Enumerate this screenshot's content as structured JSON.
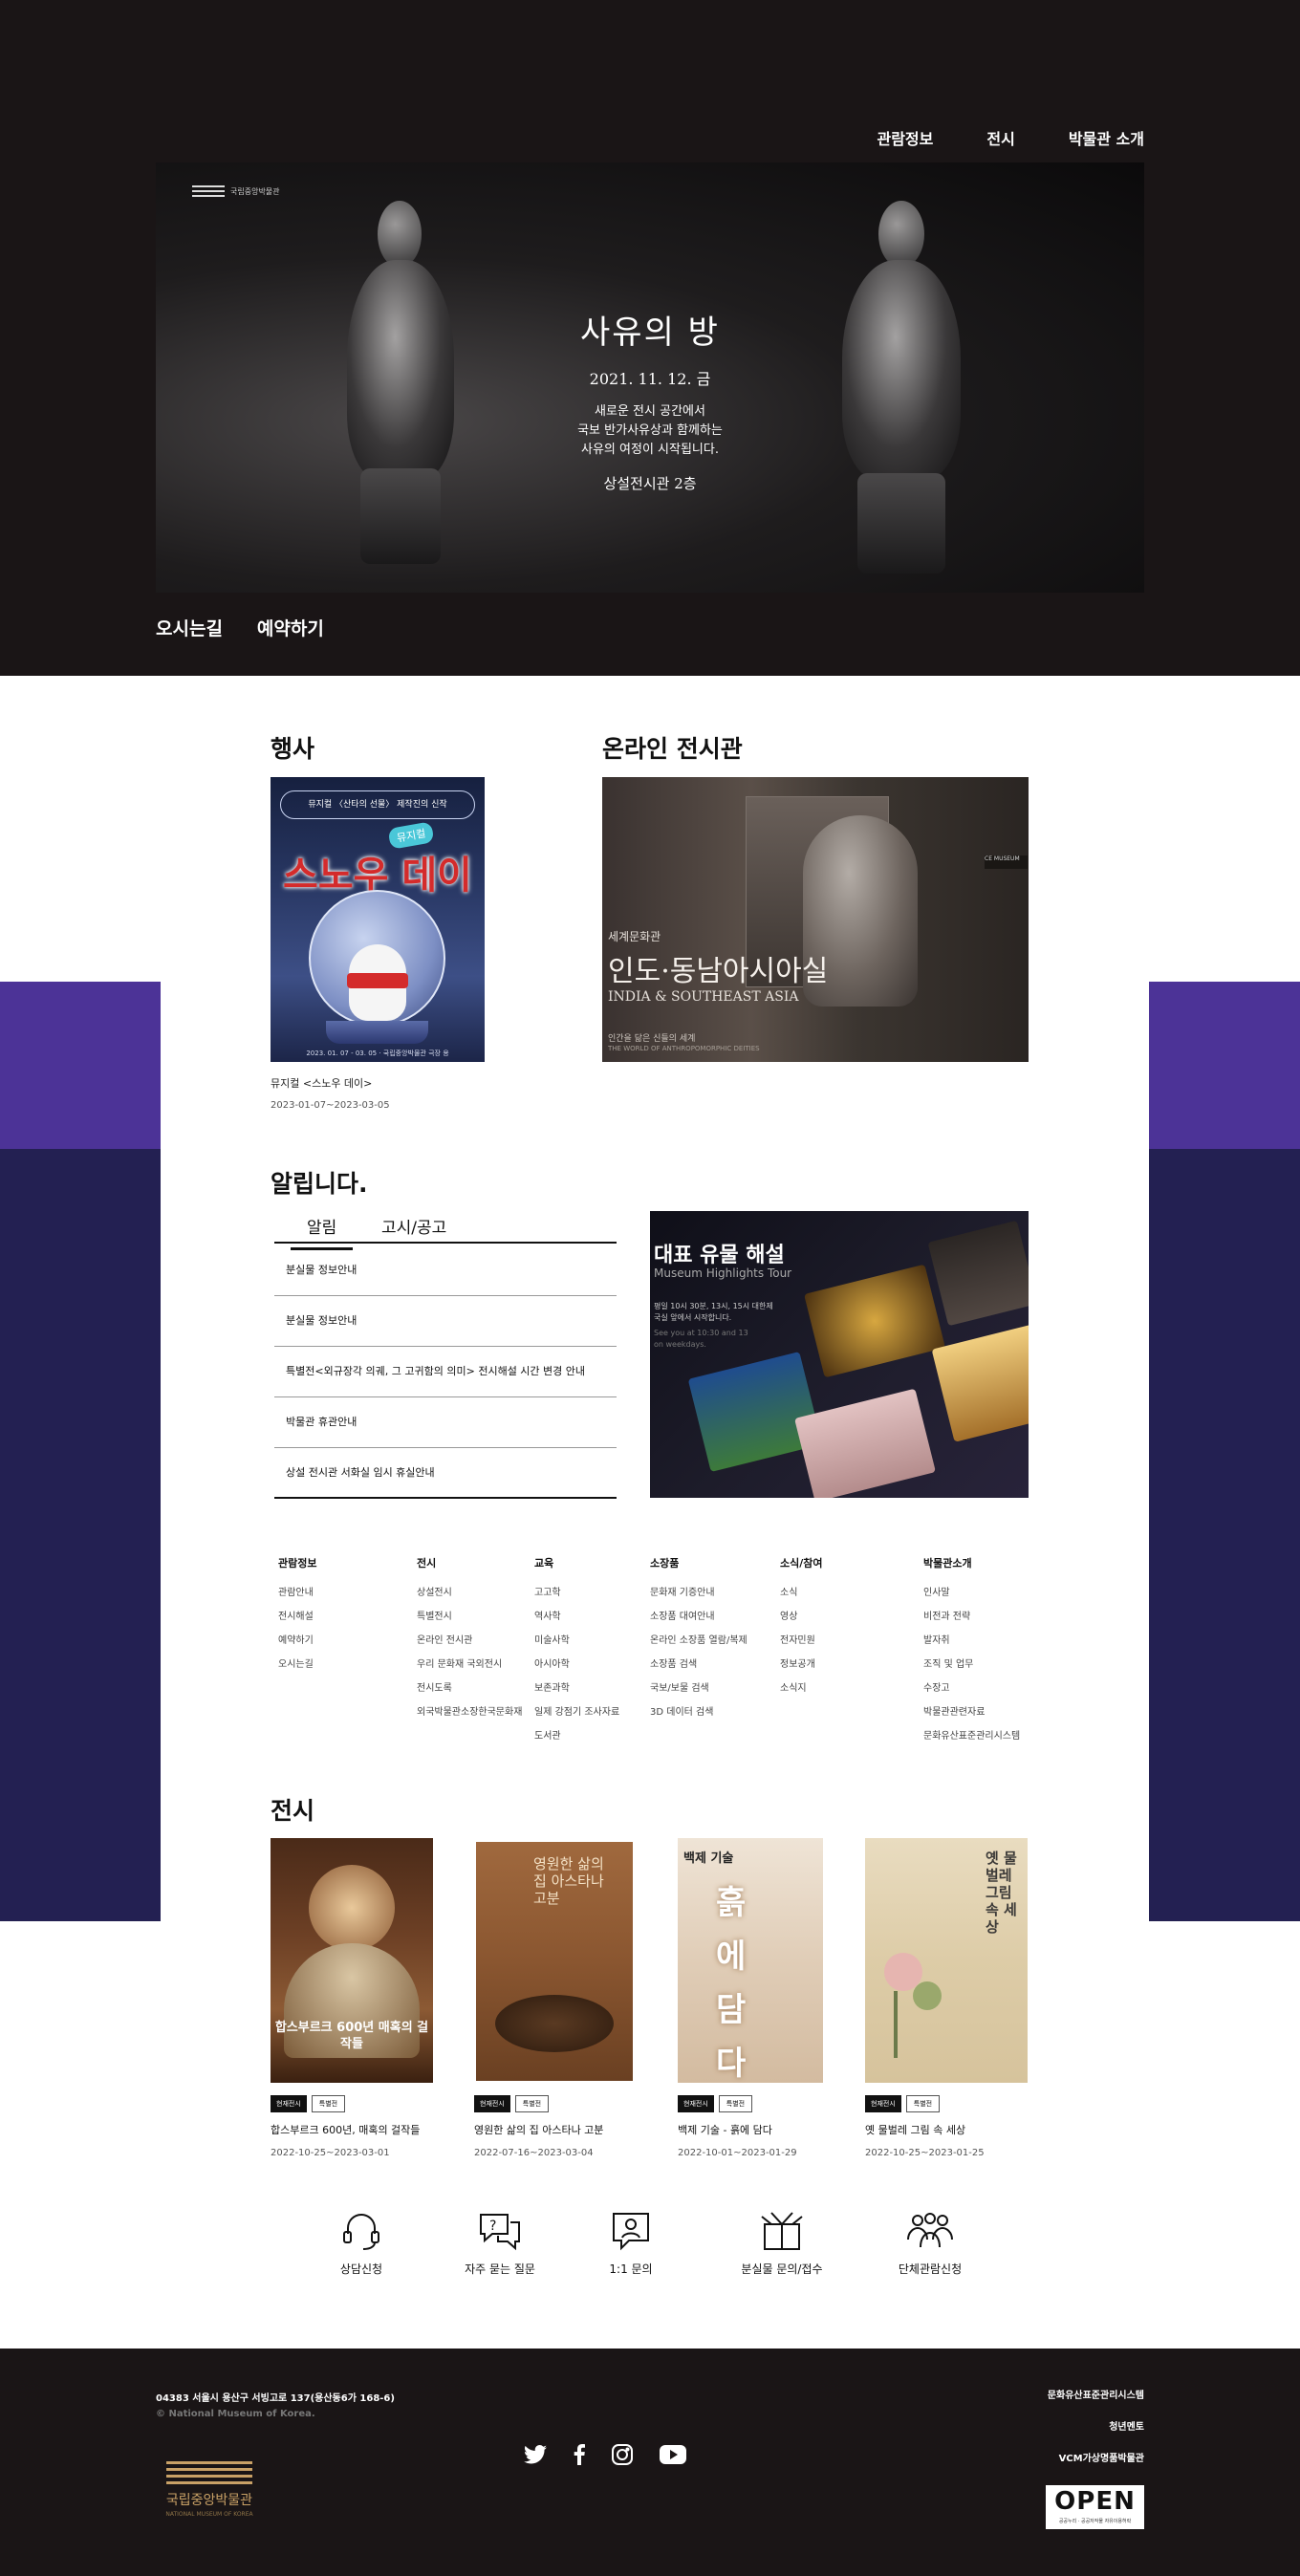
{
  "top_nav": [
    "관람정보",
    "전시",
    "박물관 소개"
  ],
  "hero": {
    "logo_text": "국립중앙박물관",
    "title": "사유의 방",
    "date": "2021. 11. 12. 금",
    "lines": [
      "새로운 전시 공간에서",
      "국보 반가사유상과 함께하는",
      "사유의 여정이 시작됩니다."
    ],
    "location": "상설전시관 2층"
  },
  "hero_links": [
    "오시는길",
    "예약하기"
  ],
  "events": {
    "title": "행사",
    "poster": {
      "header": "뮤지컬 〈산타의 선물〉 제작진의 신작",
      "tag": "뮤지컬",
      "title": "스노우 데이",
      "footer": "2023. 01. 07 - 03. 05 · 국립중앙박물관 극장 용"
    },
    "caption": "뮤지컬 <스노우 데이>",
    "date": "2023-01-07~2023-03-05"
  },
  "online": {
    "title": "온라인 전시관",
    "sign": "CE MUSEUM",
    "subtitle": "세계문화관",
    "name": "인도·동남아시아실",
    "name_en": "INDIA & SOUTHEAST ASIA",
    "desc": "인간을 닮은 신들의 세계",
    "desc_en": "THE WORLD OF ANTHROPOMORPHIC DEITIES"
  },
  "notices": {
    "title": "알립니다.",
    "tabs": [
      "알림",
      "고시/공고"
    ],
    "items": [
      "분실물 정보안내",
      "분실물 정보안내",
      "특별전<외규장각 의궤, 그 고귀함의 의미> 전시해설 시간 변경 안내",
      "박물관 휴관안내",
      "상설 전시관 서화실 임시 휴실안내"
    ]
  },
  "highlights": {
    "title": "대표 유물 해설",
    "subtitle": "Museum Highlights Tour",
    "desc": "평일 10시 30분, 13시, 15시 대한제국실 앞에서 시작합니다.",
    "desc_en": "See you at 10:30 and 13 on weekdays."
  },
  "link_columns": [
    {
      "head": "관람정보",
      "items": [
        "관람안내",
        "전시해설",
        "예약하기",
        "오시는길"
      ]
    },
    {
      "head": "전시",
      "items": [
        "상설전시",
        "특별전시",
        "온라인 전시관",
        "우리 문화재 국외전시",
        "전시도록",
        "외국박물관소장한국문화재"
      ]
    },
    {
      "head": "교육",
      "items": [
        "고고학",
        "역사학",
        "미술사학",
        "아시아학",
        "보존과학",
        "일제 강점기 조사자료",
        "도서관"
      ]
    },
    {
      "head": "소장품",
      "items": [
        "문화재 기증안내",
        "소장품 대여안내",
        "온라인 소장품 열람/복제",
        "소장품 검색",
        "국보/보물 검색",
        "3D 데이터 검색"
      ]
    },
    {
      "head": "소식/참여",
      "items": [
        "소식",
        "영상",
        "전자민원",
        "정보공개",
        "소식지"
      ]
    },
    {
      "head": "박물관소개",
      "items": [
        "인사말",
        "비전과 전략",
        "발자취",
        "조직 및 업무",
        "수장고",
        "박물관관련자료",
        "문화유산표준관리시스템"
      ]
    }
  ],
  "exhibitions": {
    "title": "전시",
    "tag_type": "현재전시",
    "tag_kind": "특별전",
    "items": [
      {
        "title": "합스부르크 600년, 매혹의 걸작들",
        "date": "2022-10-25~2023-03-01",
        "poster_text": "합스부르크 600년 매혹의 걸작들"
      },
      {
        "title": "영원한 삶의 집 아스타나 고분",
        "date": "2022-07-16~2023-03-04",
        "poster_text": "영원한 삶의 집 아스타나 고분"
      },
      {
        "title": "백제 기술 - 흙에 담다",
        "date": "2022-10-01~2023-01-29",
        "poster_text": "흙에 담다"
      },
      {
        "title": "옛 물벌레 그림 속 세상",
        "date": "2022-10-25~2023-01-25",
        "poster_text": "옛 물벌레 그림 속 세상"
      }
    ]
  },
  "services": [
    "상담신청",
    "자주 묻는 질문",
    "1:1 문의",
    "분실물 문의/접수",
    "단체관람신청"
  ],
  "footer": {
    "address": "04383 서울시 용산구 서빙고로 137(용산동6가 168-6)",
    "copyright": "© National Museum of Korea.",
    "logo_name": "국립중앙박물관",
    "logo_sub": "NATIONAL MUSEUM OF KOREA",
    "links": [
      "문화유산표준관리시스템",
      "청년멘토",
      "VCM가상명품박물관"
    ],
    "open_badge": "OPEN",
    "open_sub": "공공누리 · 공공저작물 자유이용허락"
  },
  "colors": {
    "dark": "#1a1516",
    "purple": "#4c3397",
    "navy": "#232052"
  }
}
